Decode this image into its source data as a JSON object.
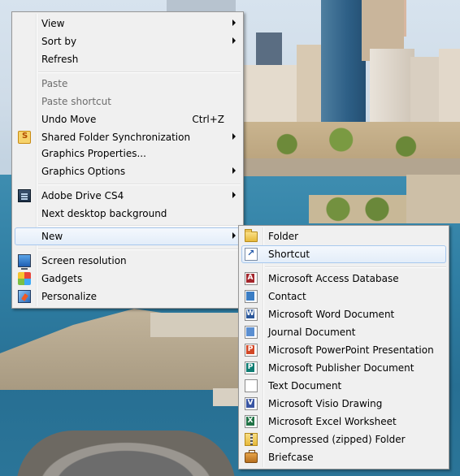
{
  "context_menu": {
    "items": [
      {
        "label": "View",
        "submenu": true
      },
      {
        "label": "Sort by",
        "submenu": true
      },
      {
        "label": "Refresh"
      },
      {
        "label": "Paste",
        "disabled": true
      },
      {
        "label": "Paste shortcut",
        "disabled": true
      },
      {
        "label": "Undo Move",
        "shortcut": "Ctrl+Z"
      },
      {
        "label": "Shared Folder Synchronization",
        "icon": "sync-icon",
        "submenu": true
      },
      {
        "label": "Graphics Properties..."
      },
      {
        "label": "Graphics Options",
        "submenu": true
      },
      {
        "label": "Adobe Drive CS4",
        "icon": "adobe-drive-icon",
        "submenu": true
      },
      {
        "label": "Next desktop background"
      },
      {
        "label": "New",
        "submenu": true,
        "highlighted": true
      },
      {
        "label": "Screen resolution",
        "icon": "monitor-icon"
      },
      {
        "label": "Gadgets",
        "icon": "gadgets-icon"
      },
      {
        "label": "Personalize",
        "icon": "personalize-icon"
      }
    ]
  },
  "new_submenu": {
    "items": [
      {
        "label": "Folder",
        "icon": "folder-icon"
      },
      {
        "label": "Shortcut",
        "icon": "shortcut-icon",
        "highlighted": true
      },
      {
        "label": "Microsoft Access Database",
        "icon": "access-icon"
      },
      {
        "label": "Contact",
        "icon": "contact-icon"
      },
      {
        "label": "Microsoft Word Document",
        "icon": "word-icon"
      },
      {
        "label": "Journal Document",
        "icon": "journal-icon"
      },
      {
        "label": "Microsoft PowerPoint Presentation",
        "icon": "powerpoint-icon"
      },
      {
        "label": "Microsoft Publisher Document",
        "icon": "publisher-icon"
      },
      {
        "label": "Text Document",
        "icon": "text-document-icon"
      },
      {
        "label": "Microsoft Visio Drawing",
        "icon": "visio-icon"
      },
      {
        "label": "Microsoft Excel Worksheet",
        "icon": "excel-icon"
      },
      {
        "label": "Compressed (zipped) Folder",
        "icon": "zip-folder-icon"
      },
      {
        "label": "Briefcase",
        "icon": "briefcase-icon"
      }
    ]
  },
  "colors": {
    "menu_background": "#f0f0f0",
    "menu_border": "#979797",
    "highlight_fill": "#e3edf9",
    "highlight_border": "#a8c8ee",
    "disabled_text": "#6d6d6d"
  }
}
